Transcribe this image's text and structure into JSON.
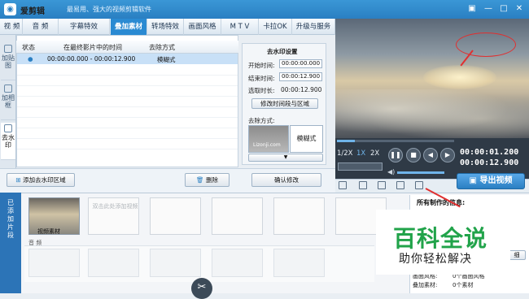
{
  "app": {
    "logo_glyph": "◉",
    "name": "爱剪辑",
    "slogan": "最易用、强大的视频剪辑软件"
  },
  "window_controls": {
    "skin": "▣",
    "minimize": "—",
    "maximize": "□",
    "close": "✕"
  },
  "tabs": [
    {
      "label": "视 频"
    },
    {
      "label": "音 频"
    },
    {
      "label": "字幕特效"
    },
    {
      "label": "叠加素材",
      "active": true
    },
    {
      "label": "转场特效"
    },
    {
      "label": "画面风格"
    },
    {
      "label": "M T V"
    },
    {
      "label": "卡拉OK"
    },
    {
      "label": "升级与服务"
    }
  ],
  "side_tabs": [
    {
      "label": "加贴图"
    },
    {
      "label": "加相框"
    },
    {
      "label": "去水印",
      "active": true
    }
  ],
  "table": {
    "headers": [
      "状态",
      "在最终影片中的时间",
      "去除方式"
    ],
    "rows": [
      {
        "status": "●",
        "time": "00:00:00.000 - 00:00:12.900",
        "method": "模糊式"
      }
    ]
  },
  "settings": {
    "title": "去水印设置",
    "start_label": "开始时间:",
    "start_value": "00:00:00.000",
    "end_label": "结束时间:",
    "end_value": "00:00:12.900",
    "duration_label": "选取时长:",
    "duration_value": "00:00:12.900",
    "modify_btn": "修改时间段与区域",
    "method_label": "去除方式:",
    "method_thumb_text": "Lizonji.com",
    "method_value": "模糊式",
    "dropdown_glyph": "▼"
  },
  "buttons": {
    "add_area": "添加去水印区域",
    "delete": "删除",
    "confirm": "确认修改"
  },
  "player": {
    "speeds": [
      "1/2X",
      "1X",
      "2X"
    ],
    "time_current": "00:00:01.200",
    "time_total": "00:00:12.900",
    "export": "导出视频"
  },
  "timeline": {
    "side_label": "已添加片段",
    "clip_label": "视频素材",
    "empty_hint": "双击此处添加视频",
    "audio_label": "音 频",
    "scissor": "✂"
  },
  "info": {
    "title": "所有制作的信息:",
    "style_label": "画面风格:",
    "style_value": "0个画面风格",
    "overlay_label": "叠加素材:",
    "overlay_value": "0个素材",
    "visible_button": "细"
  },
  "watermark": {
    "main": "百科全说",
    "sub": "助你轻松解决"
  }
}
